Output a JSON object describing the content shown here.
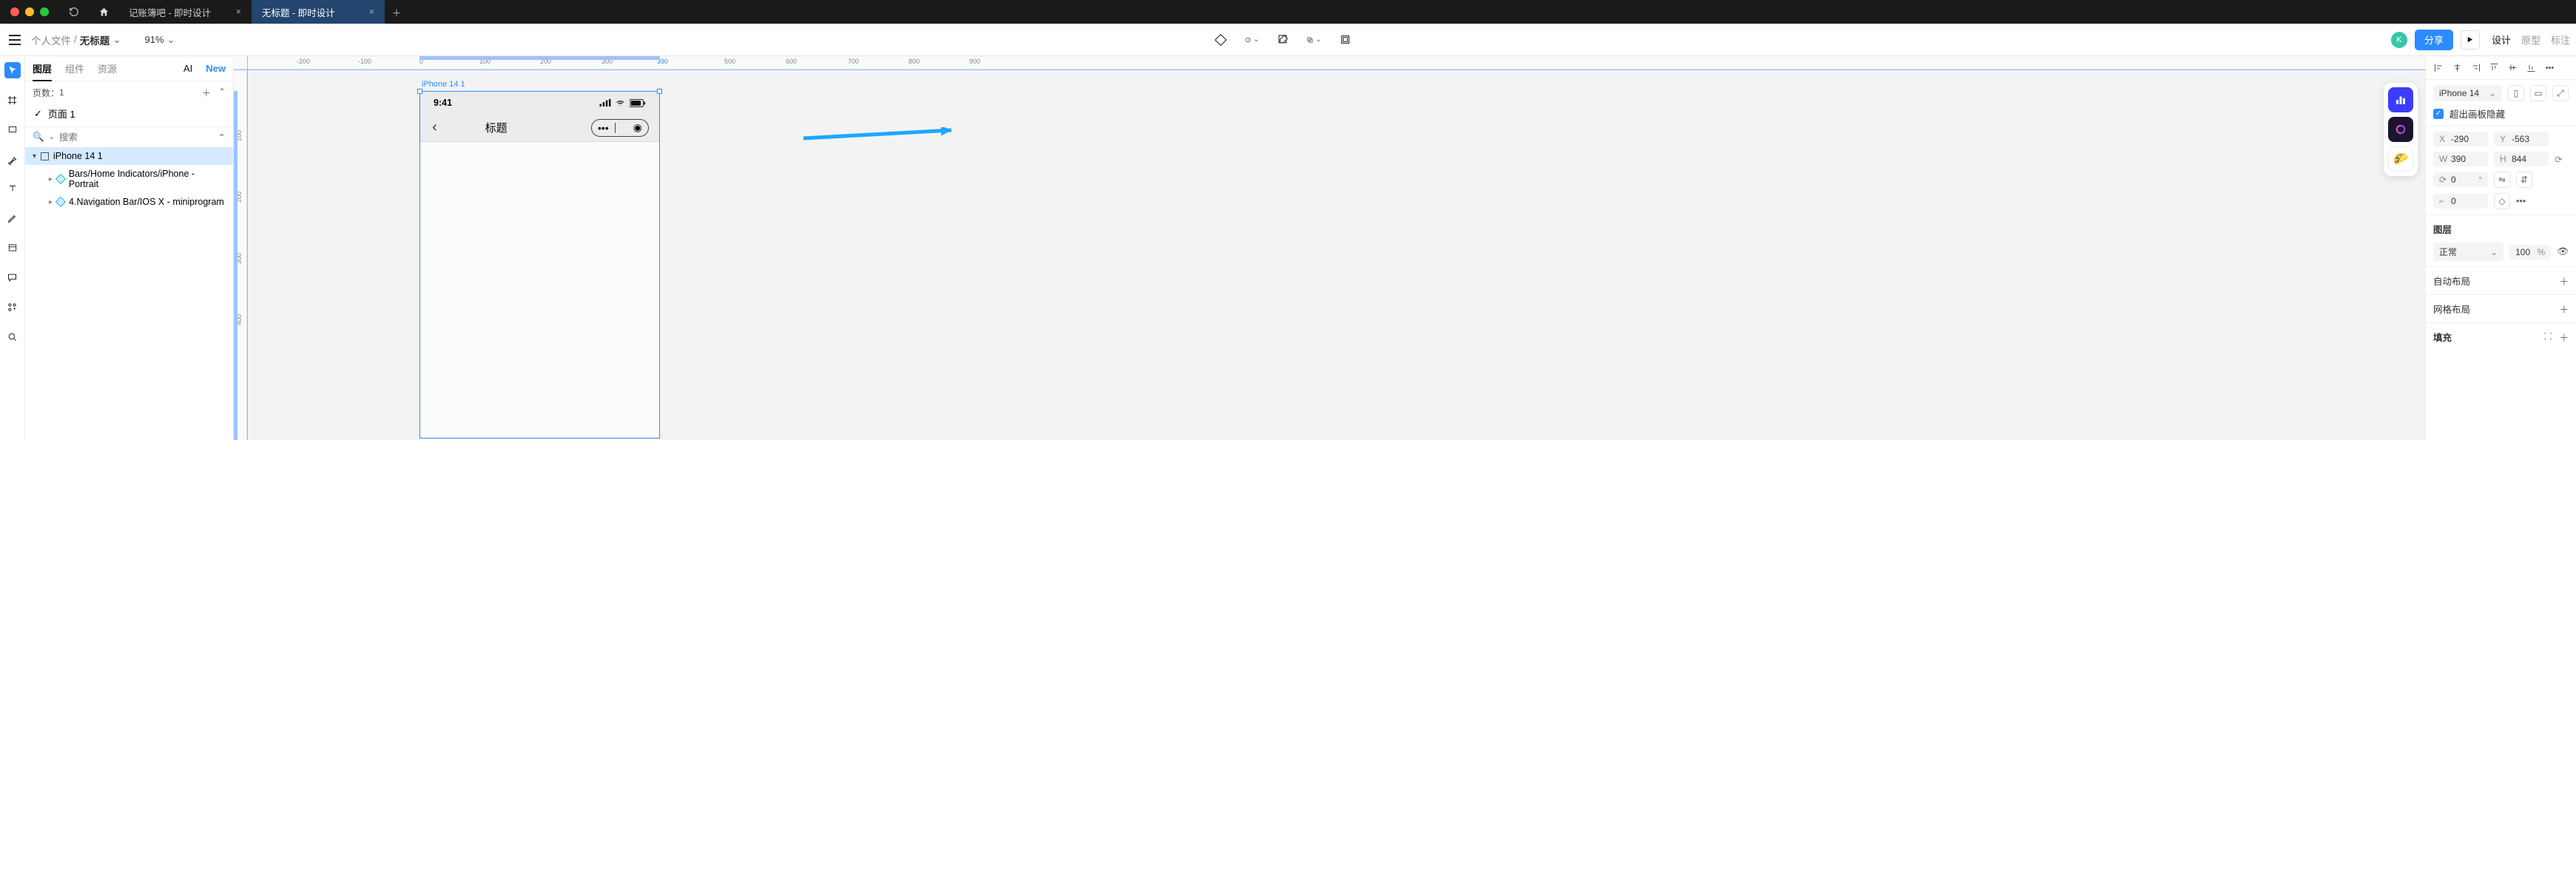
{
  "titlebar": {
    "tabs": [
      {
        "label": "记账簿吧 - 即时设计",
        "active": false
      },
      {
        "label": "无标题 - 即时设计",
        "active": true
      }
    ]
  },
  "topbar": {
    "breadcrumb_parent": "个人文件",
    "breadcrumb_current": "无标题",
    "zoom": "91%",
    "avatar_letter": "K",
    "share_label": "分享",
    "modes": {
      "design": "设计",
      "prototype": "原型",
      "annotate": "标注"
    }
  },
  "left_panel": {
    "tabs": {
      "layers": "图层",
      "components": "组件",
      "assets": "资源",
      "ai": "AI",
      "new": "New"
    },
    "pages_label": "页数：",
    "pages_count": "1",
    "pages": [
      {
        "name": "页面 1"
      }
    ],
    "search_placeholder": "搜索",
    "layers": [
      {
        "name": "iPhone 14 1",
        "selected": true,
        "icon": "frame",
        "depth": 0
      },
      {
        "name": "Bars/Home Indicators/iPhone - Portrait",
        "selected": false,
        "icon": "component",
        "depth": 1
      },
      {
        "name": "4.Navigation Bar/IOS X - miniprogram",
        "selected": false,
        "icon": "component",
        "depth": 1
      }
    ]
  },
  "ruler_h": [
    "-200",
    "-100",
    "0",
    "100",
    "200",
    "300",
    "390",
    "500",
    "600",
    "700",
    "800",
    "900"
  ],
  "ruler_v": [
    "100",
    "200",
    "300",
    "400"
  ],
  "canvas": {
    "artboard_label": "iPhone 14 1",
    "status_time": "9:41",
    "nav_title": "标题"
  },
  "right_panel": {
    "frame_preset": "iPhone 14",
    "clip_label": "超出画板隐藏",
    "X": "-290",
    "Y": "-563",
    "W": "390",
    "H": "844",
    "rotation": "0",
    "radius": "0",
    "section_layer": "图层",
    "blend_mode": "正常",
    "opacity_value": "100",
    "opacity_unit": "%",
    "section_autolayout": "自动布局",
    "section_gridlayout": "网格布局",
    "section_fill": "填充"
  }
}
